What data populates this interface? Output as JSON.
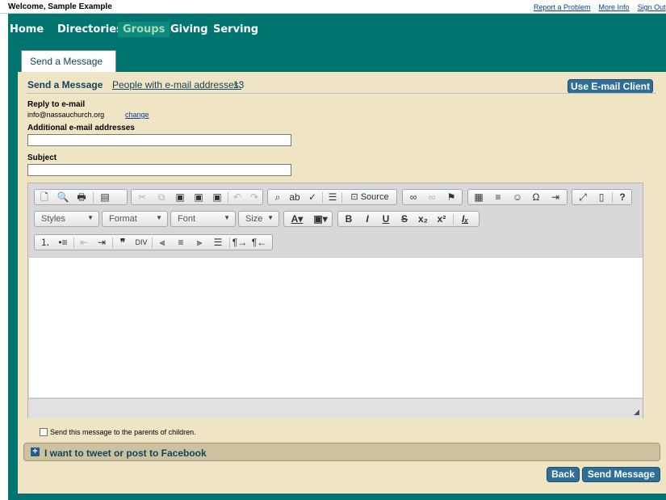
{
  "topbar": {
    "welcome": "Welcome, Sample Example",
    "links": [
      "Report a Problem",
      "More Info",
      "Sign Out"
    ]
  },
  "nav": {
    "items": [
      "Home",
      "Directories",
      "Groups",
      "Giving",
      "Serving"
    ],
    "active": "Groups"
  },
  "tab": {
    "label": "Send a Message"
  },
  "header": {
    "title": "Send a Message",
    "people_link": "People with e-mail addresses:",
    "people_count": "13",
    "email_client_button": "Use E-mail Client"
  },
  "form": {
    "reply_label": "Reply to e-mail",
    "reply_email": "info@nassauchurch.org",
    "change_link": "change",
    "additional_label": "Additional e-mail addresses",
    "additional_value": "",
    "subject_label": "Subject",
    "subject_value": ""
  },
  "editor": {
    "source_label": "Source",
    "styles_label": "Styles",
    "format_label": "Format",
    "font_label": "Font",
    "size_label": "Size",
    "body_text": ""
  },
  "options": {
    "parents_label": "Send this message to the parents of children.",
    "parents_checked": false,
    "tweet_label": "I want to tweet or post to Facebook"
  },
  "buttons": {
    "back": "Back",
    "send": "Send Message"
  },
  "colors": {
    "nav_bg": "#00756f",
    "panel_bg": "#efe5c5",
    "button_bg": "#2f6e96",
    "link": "#13435e"
  }
}
